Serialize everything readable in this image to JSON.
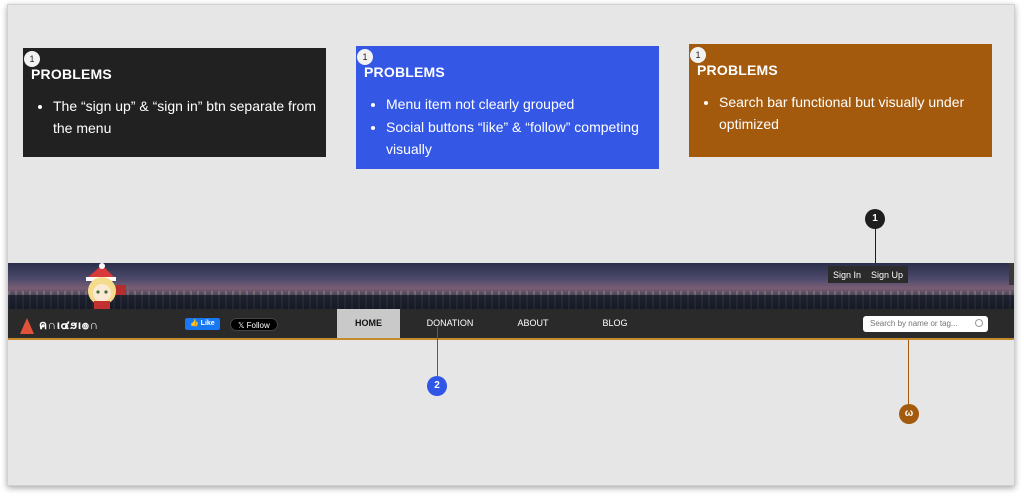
{
  "cards": [
    {
      "badge": "1",
      "title": "PROBLEMS",
      "items": [
        "The “sign up” & “sign in” btn separate from the menu"
      ]
    },
    {
      "badge": "1",
      "title": "PROBLEMS",
      "items": [
        "Menu item not clearly grouped",
        "Social buttons “like” & “follow” competing visually"
      ]
    },
    {
      "badge": "1",
      "title": "PROBLEMS",
      "items": [
        "Search bar functional but visually under optimized"
      ]
    }
  ],
  "site": {
    "logo_text": "ค∩ι๔ϧι๏∩",
    "sign_in": "Sign In",
    "sign_up": "Sign Up",
    "like": "Like",
    "follow": "𝕏 Follow",
    "nav": [
      "HOME",
      "DONATION",
      "ABOUT",
      "BLOG"
    ],
    "search_placeholder": "Search by name or tag..."
  },
  "markers": [
    "1",
    "2",
    "ω"
  ],
  "colors": {
    "dark": "#212121",
    "blue": "#3457e6",
    "orange": "#a45a0d"
  }
}
